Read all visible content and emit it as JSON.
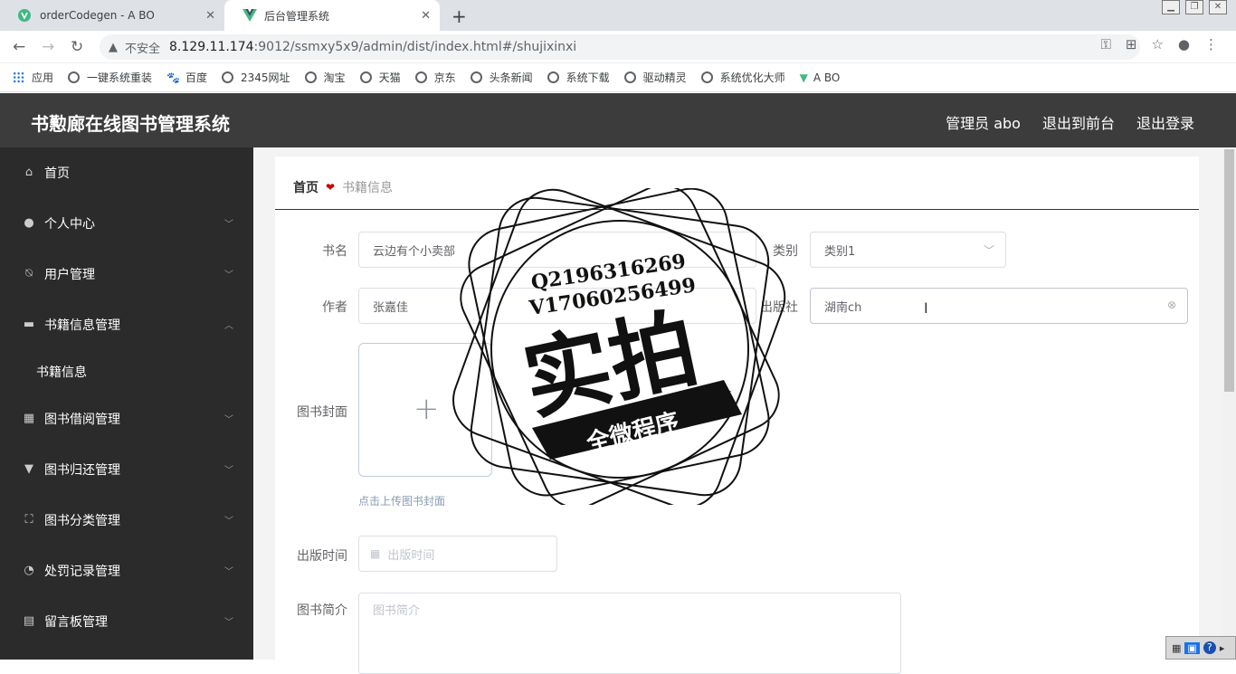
{
  "browser": {
    "tabs": [
      {
        "title": "orderCodegen - A BO",
        "active": false
      },
      {
        "title": "后台管理系统",
        "active": true
      }
    ],
    "address": {
      "security": "不安全",
      "host": "8.129.11.174",
      "path": ":9012/ssmxy5x9/admin/dist/index.html#/shujixinxi"
    },
    "bookmarks": [
      "应用",
      "一键系统重装",
      "百度",
      "2345网址",
      "淘宝",
      "天猫",
      "京东",
      "头条新闻",
      "系统下载",
      "驱动精灵",
      "系统优化大师",
      "A BO"
    ]
  },
  "app": {
    "title": "书懃廊在线图书管理系统",
    "nav": [
      "管理员 abo",
      "退出到前台",
      "退出登录"
    ]
  },
  "sidebar": {
    "items": [
      {
        "label": "首页",
        "icon": "home-icon",
        "chevron": ""
      },
      {
        "label": "个人中心",
        "icon": "user-icon",
        "chevron": "down"
      },
      {
        "label": "用户管理",
        "icon": "bell-off-icon",
        "chevron": "down"
      },
      {
        "label": "书籍信息管理",
        "icon": "ticket-icon",
        "chevron": "up"
      },
      {
        "label": "书籍信息",
        "icon": "",
        "chevron": "",
        "sub": true
      },
      {
        "label": "图书借阅管理",
        "icon": "grid-icon",
        "chevron": "down"
      },
      {
        "label": "图书归还管理",
        "icon": "stamp-icon",
        "chevron": "down"
      },
      {
        "label": "图书分类管理",
        "icon": "fullscreen-icon",
        "chevron": "down"
      },
      {
        "label": "处罚记录管理",
        "icon": "compass-icon",
        "chevron": "down"
      },
      {
        "label": "留言板管理",
        "icon": "clipboard-icon",
        "chevron": "down"
      }
    ]
  },
  "breadcrumb": {
    "home": "首页",
    "current": "书籍信息"
  },
  "form": {
    "book_name": {
      "label": "书名",
      "value": "云边有个小卖部"
    },
    "category": {
      "label": "类别",
      "value": "类别1"
    },
    "author": {
      "label": "作者",
      "value": "张嘉佳"
    },
    "publisher": {
      "label": "出版社",
      "value": "湖南ch"
    },
    "cover": {
      "label": "图书封面",
      "hint": "点击上传图书封面"
    },
    "pub_date": {
      "label": "出版时间",
      "placeholder": "出版时间"
    },
    "intro": {
      "label": "图书简介",
      "placeholder": "图书简介"
    }
  },
  "watermark": {
    "line1": "Q2196316269",
    "line2": "V17060256499",
    "big": "实拍",
    "banner": "全微程序"
  },
  "colors": {
    "header": "#3c3c3c",
    "sidebar": "#2b2b2b",
    "accent_heart": "#cc0000"
  }
}
